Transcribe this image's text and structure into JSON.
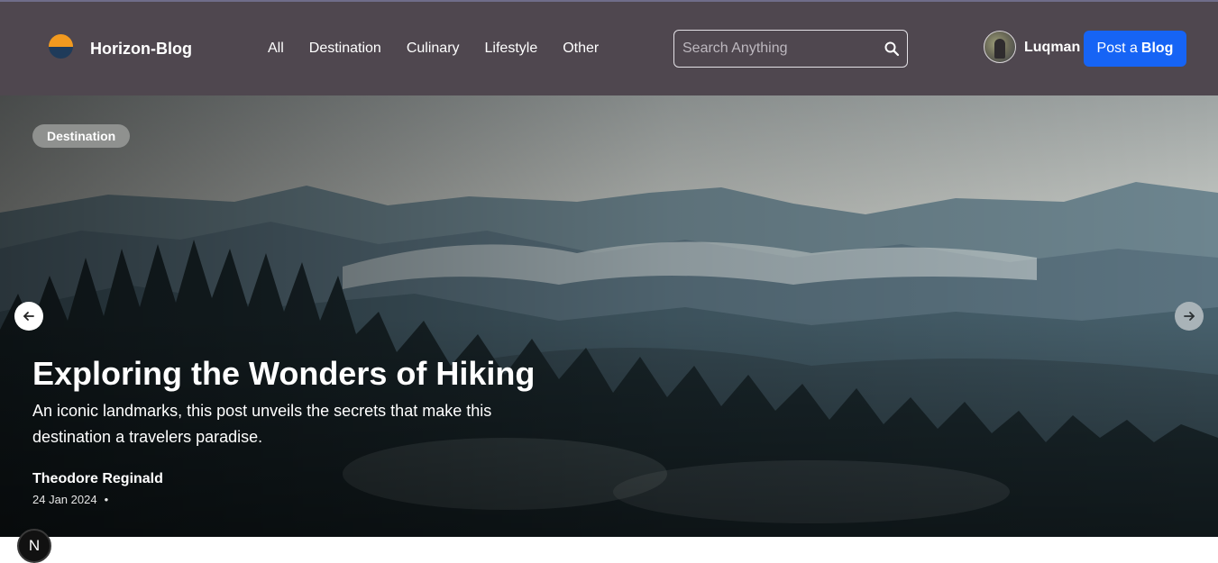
{
  "brand": {
    "name": "Horizon-Blog",
    "logo_icon": "sunset-logo-icon"
  },
  "nav": {
    "items": [
      {
        "label": "All"
      },
      {
        "label": "Destination"
      },
      {
        "label": "Culinary"
      },
      {
        "label": "Lifestyle"
      },
      {
        "label": "Other"
      }
    ]
  },
  "search": {
    "placeholder": "Search Anything",
    "value": "",
    "icon": "search-icon"
  },
  "user": {
    "name": "Luqman",
    "avatar_icon": "user-avatar"
  },
  "post_button": {
    "label_prefix": "Post a",
    "label_bold": "Blog",
    "color": "#1664f5"
  },
  "hero": {
    "tag": "Destination",
    "title": "Exploring the Wonders of Hiking",
    "subtitle": "An iconic landmarks, this post unveils the secrets that make this destination a travelers paradise.",
    "author": "Theodore Reginald",
    "date": "24 Jan 2024",
    "separator": "•",
    "prev_icon": "arrow-left-icon",
    "next_icon": "arrow-right-icon"
  },
  "dev_badge": {
    "letter": "N"
  },
  "colors": {
    "header_bg": "#4f474f",
    "accent": "#1664f5"
  }
}
